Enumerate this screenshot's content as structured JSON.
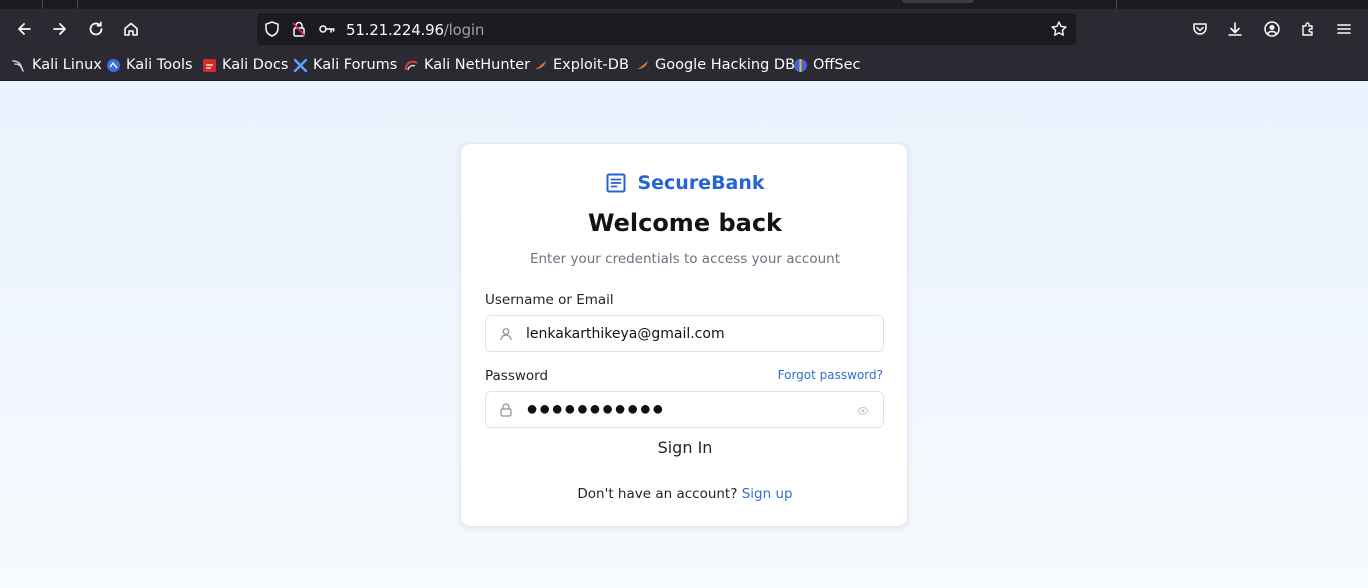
{
  "browser": {
    "url_host": "51.21.224.96",
    "url_path": "/login",
    "bookmarks": [
      {
        "label": "Kali Linux",
        "icon": "kali-dragon-icon"
      },
      {
        "label": "Kali Tools",
        "icon": "kali-tools-icon"
      },
      {
        "label": "Kali Docs",
        "icon": "kali-docs-icon"
      },
      {
        "label": "Kali Forums",
        "icon": "kali-forums-icon"
      },
      {
        "label": "Kali NetHunter",
        "icon": "nethunter-icon"
      },
      {
        "label": "Exploit-DB",
        "icon": "exploit-db-icon"
      },
      {
        "label": "Google Hacking DB",
        "icon": "ghdb-icon"
      },
      {
        "label": "OffSec",
        "icon": "offsec-icon"
      }
    ]
  },
  "login": {
    "brand": "SecureBank",
    "title": "Welcome back",
    "subtitle": "Enter your credentials to access your account",
    "username_label": "Username or Email",
    "username_value": "lenkakarthikeya@gmail.com",
    "password_label": "Password",
    "forgot_link": "Forgot password?",
    "password_masked": "●●●●●●●●●●●",
    "signin_label": "Sign In",
    "signup_prompt": "Don't have an account?",
    "signup_link": "Sign up"
  },
  "colors": {
    "accent": "#2563d6",
    "link": "#2f6fd8",
    "chrome_bg": "#2b2a33",
    "urlbar_bg": "#1c1b22"
  }
}
